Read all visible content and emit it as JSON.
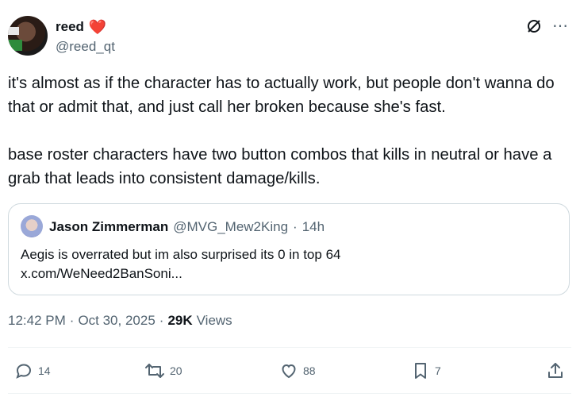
{
  "author": {
    "display_name": "reed",
    "emoji": "❤️",
    "handle": "@reed_qt"
  },
  "tweet": {
    "paragraphs": [
      "it's almost as if the character has to actually work, but people don't wanna do that or admit that, and just call her broken because she's fast.",
      "base roster characters have two button combos that kills in neutral or have a grab that leads into consistent damage/kills."
    ]
  },
  "quote": {
    "display_name": "Jason Zimmerman",
    "handle": "@MVG_Mew2King",
    "separator": "·",
    "time": "14h",
    "text_line1": "Aegis is overrated but im also surprised its 0 in top 64",
    "text_line2": "x.com/WeNeed2BanSoni..."
  },
  "meta": {
    "time": "12:42 PM",
    "sep1": "·",
    "date": "Oct 30, 2025",
    "sep2": "·",
    "views_count": "29K",
    "views_label": "Views"
  },
  "actions": {
    "reply_count": "14",
    "repost_count": "20",
    "like_count": "88",
    "bookmark_count": "7"
  },
  "icons": {
    "top": [
      "grok-icon",
      "more-icon"
    ],
    "actions": [
      "reply-icon",
      "repost-icon",
      "like-icon",
      "bookmark-icon",
      "share-icon"
    ]
  },
  "colors": {
    "text": "#0f1419",
    "secondary": "#536471",
    "border": "#cfd9de",
    "heart": "#d0102b"
  }
}
